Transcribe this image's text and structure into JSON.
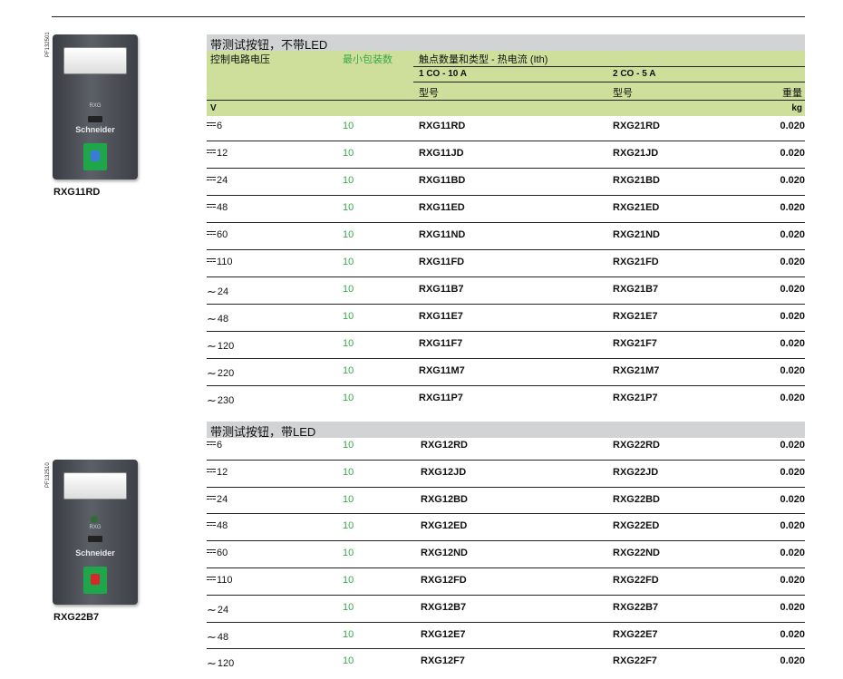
{
  "products": [
    {
      "code": "PF132501",
      "label": "RXG11RD",
      "relay_text": "RXG",
      "brand": "Schneider",
      "button_color": "#3a7bd5",
      "led": false
    },
    {
      "code": "PF132510",
      "label": "RXG22B7",
      "relay_text": "RXG",
      "brand": "Schneider",
      "button_color": "#d22a2a",
      "led": true
    }
  ],
  "section1_title": "带测试按钮，不带LED",
  "section2_title": "带测试按钮，带LED",
  "header": {
    "col_voltage": "控制电路电压",
    "col_pack": "最小包装数",
    "col_contacts": "触点数量和类型 - 热电流 (Ith)",
    "co1": "1 CO - 10 A",
    "co2": "2 CO - 5 A",
    "ref1": "型号",
    "ref2": "型号",
    "weight": "重量",
    "unit_v": "V",
    "unit_kg": "kg"
  },
  "rows1": [
    {
      "type": "dc",
      "v": "6",
      "pack": "10",
      "r1": "RXG11RD",
      "r2": "RXG21RD",
      "w": "0.020"
    },
    {
      "type": "dc",
      "v": "12",
      "pack": "10",
      "r1": "RXG11JD",
      "r2": "RXG21JD",
      "w": "0.020"
    },
    {
      "type": "dc",
      "v": "24",
      "pack": "10",
      "r1": "RXG11BD",
      "r2": "RXG21BD",
      "w": "0.020"
    },
    {
      "type": "dc",
      "v": "48",
      "pack": "10",
      "r1": "RXG11ED",
      "r2": "RXG21ED",
      "w": "0.020"
    },
    {
      "type": "dc",
      "v": "60",
      "pack": "10",
      "r1": "RXG11ND",
      "r2": "RXG21ND",
      "w": "0.020"
    },
    {
      "type": "dc",
      "v": "110",
      "pack": "10",
      "r1": "RXG11FD",
      "r2": "RXG21FD",
      "w": "0.020"
    },
    {
      "type": "ac",
      "v": "24",
      "pack": "10",
      "r1": "RXG11B7",
      "r2": "RXG21B7",
      "w": "0.020"
    },
    {
      "type": "ac",
      "v": "48",
      "pack": "10",
      "r1": "RXG11E7",
      "r2": "RXG21E7",
      "w": "0.020"
    },
    {
      "type": "ac",
      "v": "120",
      "pack": "10",
      "r1": "RXG11F7",
      "r2": "RXG21F7",
      "w": "0.020"
    },
    {
      "type": "ac",
      "v": "220",
      "pack": "10",
      "r1": "RXG11M7",
      "r2": "RXG21M7",
      "w": "0.020"
    },
    {
      "type": "ac",
      "v": "230",
      "pack": "10",
      "r1": "RXG11P7",
      "r2": "RXG21P7",
      "w": "0.020"
    }
  ],
  "rows2": [
    {
      "type": "dc",
      "v": "6",
      "pack": "10",
      "r1": "RXG12RD",
      "r2": "RXG22RD",
      "w": "0.020"
    },
    {
      "type": "dc",
      "v": "12",
      "pack": "10",
      "r1": "RXG12JD",
      "r2": "RXG22JD",
      "w": "0.020"
    },
    {
      "type": "dc",
      "v": "24",
      "pack": "10",
      "r1": "RXG12BD",
      "r2": "RXG22BD",
      "w": "0.020"
    },
    {
      "type": "dc",
      "v": "48",
      "pack": "10",
      "r1": "RXG12ED",
      "r2": "RXG22ED",
      "w": "0.020"
    },
    {
      "type": "dc",
      "v": "60",
      "pack": "10",
      "r1": "RXG12ND",
      "r2": "RXG22ND",
      "w": "0.020"
    },
    {
      "type": "dc",
      "v": "110",
      "pack": "10",
      "r1": "RXG12FD",
      "r2": "RXG22FD",
      "w": "0.020"
    },
    {
      "type": "ac",
      "v": "24",
      "pack": "10",
      "r1": "RXG12B7",
      "r2": "RXG22B7",
      "w": "0.020"
    },
    {
      "type": "ac",
      "v": "48",
      "pack": "10",
      "r1": "RXG12E7",
      "r2": "RXG22E7",
      "w": "0.020"
    },
    {
      "type": "ac",
      "v": "120",
      "pack": "10",
      "r1": "RXG12F7",
      "r2": "RXG22F7",
      "w": "0.020"
    }
  ]
}
